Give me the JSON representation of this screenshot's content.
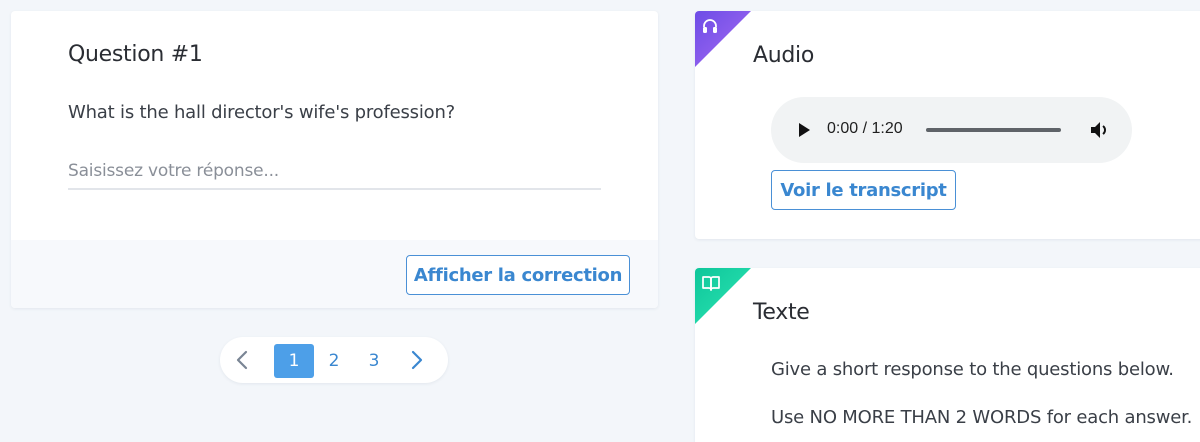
{
  "question": {
    "title": "Question #1",
    "text": "What is the hall director's wife's profession?",
    "input_placeholder": "Saisissez votre réponse...",
    "input_value": "",
    "show_correction_label": "Afficher la correction"
  },
  "pagination": {
    "pages": [
      "1",
      "2",
      "3"
    ],
    "active_page": "1",
    "prev_icon": "chevron-left",
    "next_icon": "chevron-right"
  },
  "audio": {
    "title": "Audio",
    "icon": "headphones",
    "accent": "#8b5cf6",
    "player": {
      "time": "0:00 / 1:20",
      "play_icon": "play",
      "volume_icon": "volume",
      "progress": 0
    },
    "transcript_label": "Voir le transcript"
  },
  "text_section": {
    "title": "Texte",
    "icon": "book",
    "accent": "#10d3a0",
    "lines": [
      "Give a short response to the questions below.",
      "Use NO MORE THAN 2 WORDS for each answer."
    ]
  },
  "colors": {
    "primary": "#3a87d0",
    "active_page_bg": "#4d9fe8",
    "background": "#f3f6fa"
  }
}
